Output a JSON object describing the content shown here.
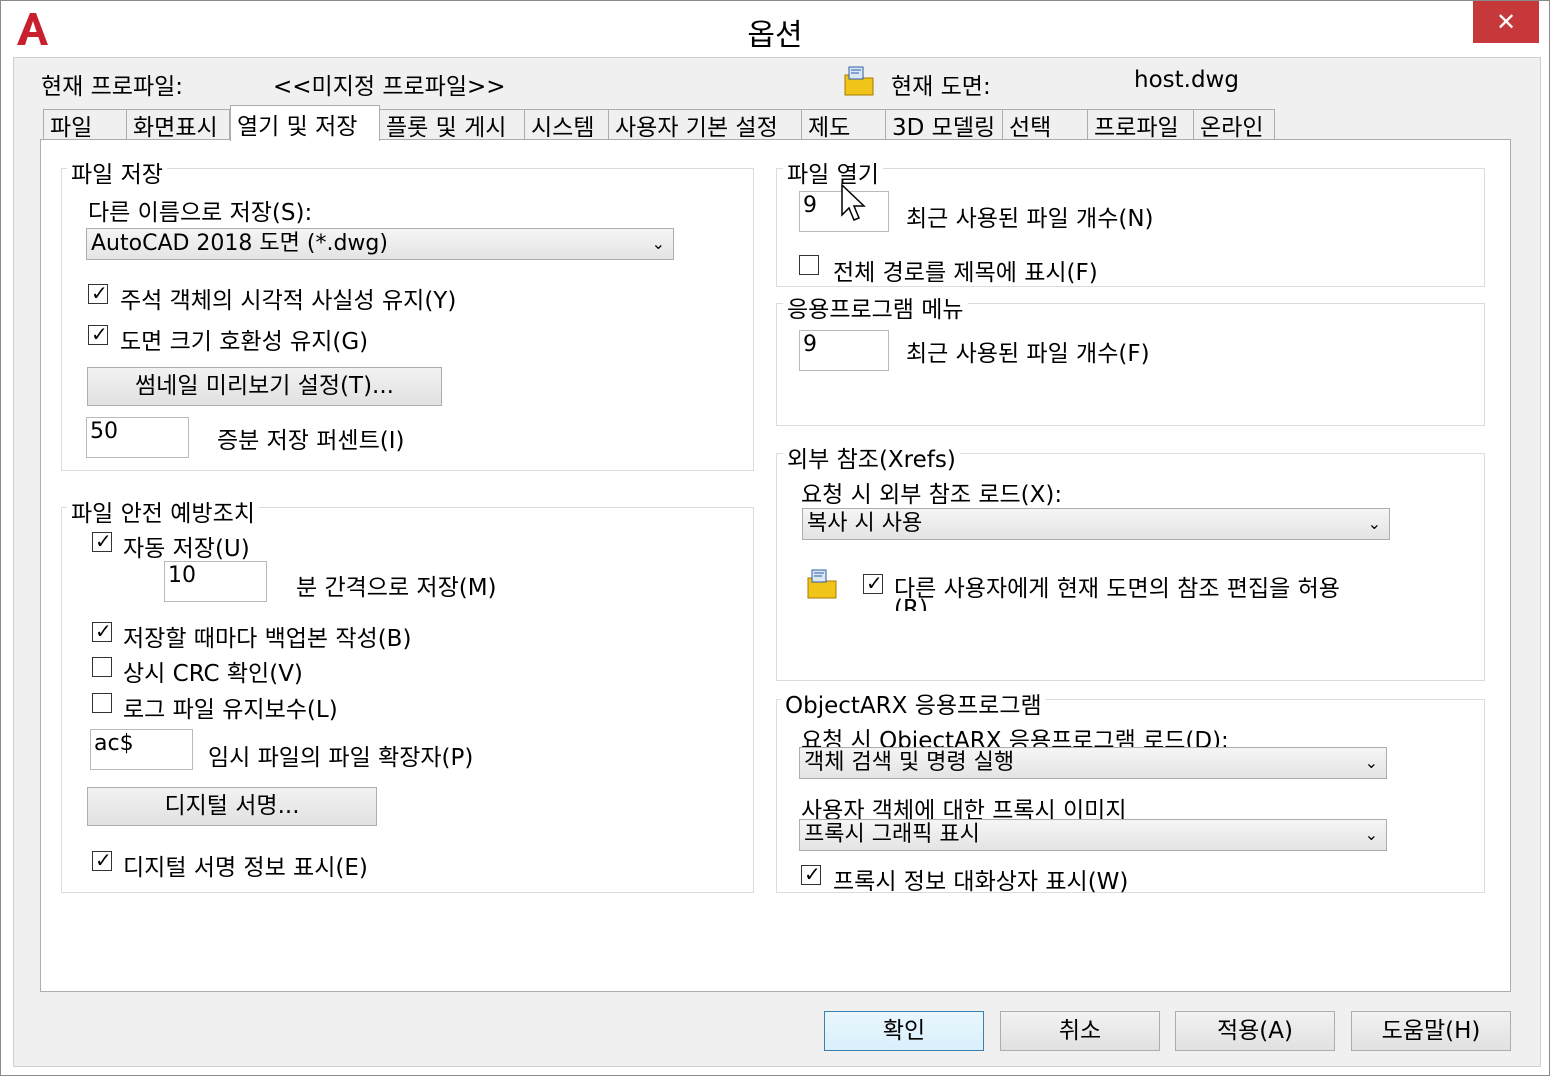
{
  "window": {
    "title": "옵션",
    "close_glyph": "✕",
    "app_icon": "autocad-logo-icon"
  },
  "profile": {
    "label": "현재 프로파일:",
    "value": "<<미지정 프로파일>>"
  },
  "drawing": {
    "label": "현재 도면:",
    "value": "host.dwg"
  },
  "tabs": [
    {
      "label": "파일"
    },
    {
      "label": "화면표시"
    },
    {
      "label": "열기 및 저장",
      "selected": true
    },
    {
      "label": "플롯 및 게시"
    },
    {
      "label": "시스템"
    },
    {
      "label": "사용자 기본 설정"
    },
    {
      "label": "제도"
    },
    {
      "label": "3D 모델링"
    },
    {
      "label": "선택"
    },
    {
      "label": "프로파일"
    },
    {
      "label": "온라인"
    }
  ],
  "file_save": {
    "title": "파일 저장",
    "saveas_label": "다른 이름으로 저장(S):",
    "saveas_value": "AutoCAD 2018 도면 (*.dwg)",
    "annot_visual": {
      "label": "주석 객체의 시각적 사실성 유지(Y)",
      "checked": true
    },
    "size_compat": {
      "label": "도면 크기 호환성 유지(G)",
      "checked": true
    },
    "thumbnail_button": "썸네일 미리보기 설정(T)...",
    "incremental_value": "50",
    "incremental_label": "증분 저장 퍼센트(I)"
  },
  "file_safety": {
    "title": "파일 안전 예방조치",
    "autosave": {
      "label": "자동 저장(U)",
      "checked": true
    },
    "interval_value": "10",
    "interval_label": "분 간격으로 저장(M)",
    "backup": {
      "label": "저장할 때마다 백업본 작성(B)",
      "checked": true
    },
    "crc": {
      "label": "상시 CRC 확인(V)",
      "checked": false
    },
    "log": {
      "label": "로그 파일 유지보수(L)",
      "checked": false
    },
    "temp_ext_value": "ac$",
    "temp_ext_label": "임시 파일의 파일 확장자(P)",
    "digital_sig_button": "디지털 서명...",
    "show_sig": {
      "label": "디지털 서명 정보 표시(E)",
      "checked": true
    }
  },
  "file_open": {
    "title": "파일 열기",
    "recent_value": "9",
    "recent_label": "최근 사용된 파일 개수(N)",
    "full_path": {
      "label": "전체 경로를 제목에 표시(F)",
      "checked": false
    }
  },
  "app_menu": {
    "title": "응용프로그램 메뉴",
    "recent_value": "9",
    "recent_label": "최근 사용된 파일 개수(F)"
  },
  "xrefs": {
    "title": "외부 참조(Xrefs)",
    "demand_label": "요청 시 외부 참조 로드(X):",
    "demand_value": "복사 시 사용",
    "allow_edit": {
      "label": "다른 사용자에게 현재 도면의 참조 편집을 허용",
      "label_cont": "(R)",
      "checked": true
    }
  },
  "objectarx": {
    "title": "ObjectARX 응용프로그램",
    "demand_label": "요청 시 ObjectARX 응용프로그램 로드(D):",
    "demand_value": "객체 검색 및 명령 실행",
    "proxy_label": "사용자 객체에 대한 프록시 이미지",
    "proxy_value": "프록시 그래픽 표시",
    "proxy_dialog": {
      "label": "프록시 정보 대화상자 표시(W)",
      "checked": true
    }
  },
  "buttons": {
    "ok": "확인",
    "cancel": "취소",
    "apply": "적용(A)",
    "help": "도움말(H)"
  },
  "glyphs": {
    "check": "✓",
    "caret": "⌄"
  },
  "colors": {
    "close_bg": "#c7383a",
    "autocad_red": "#c8202f",
    "folder_yellow": "#f0c419"
  }
}
